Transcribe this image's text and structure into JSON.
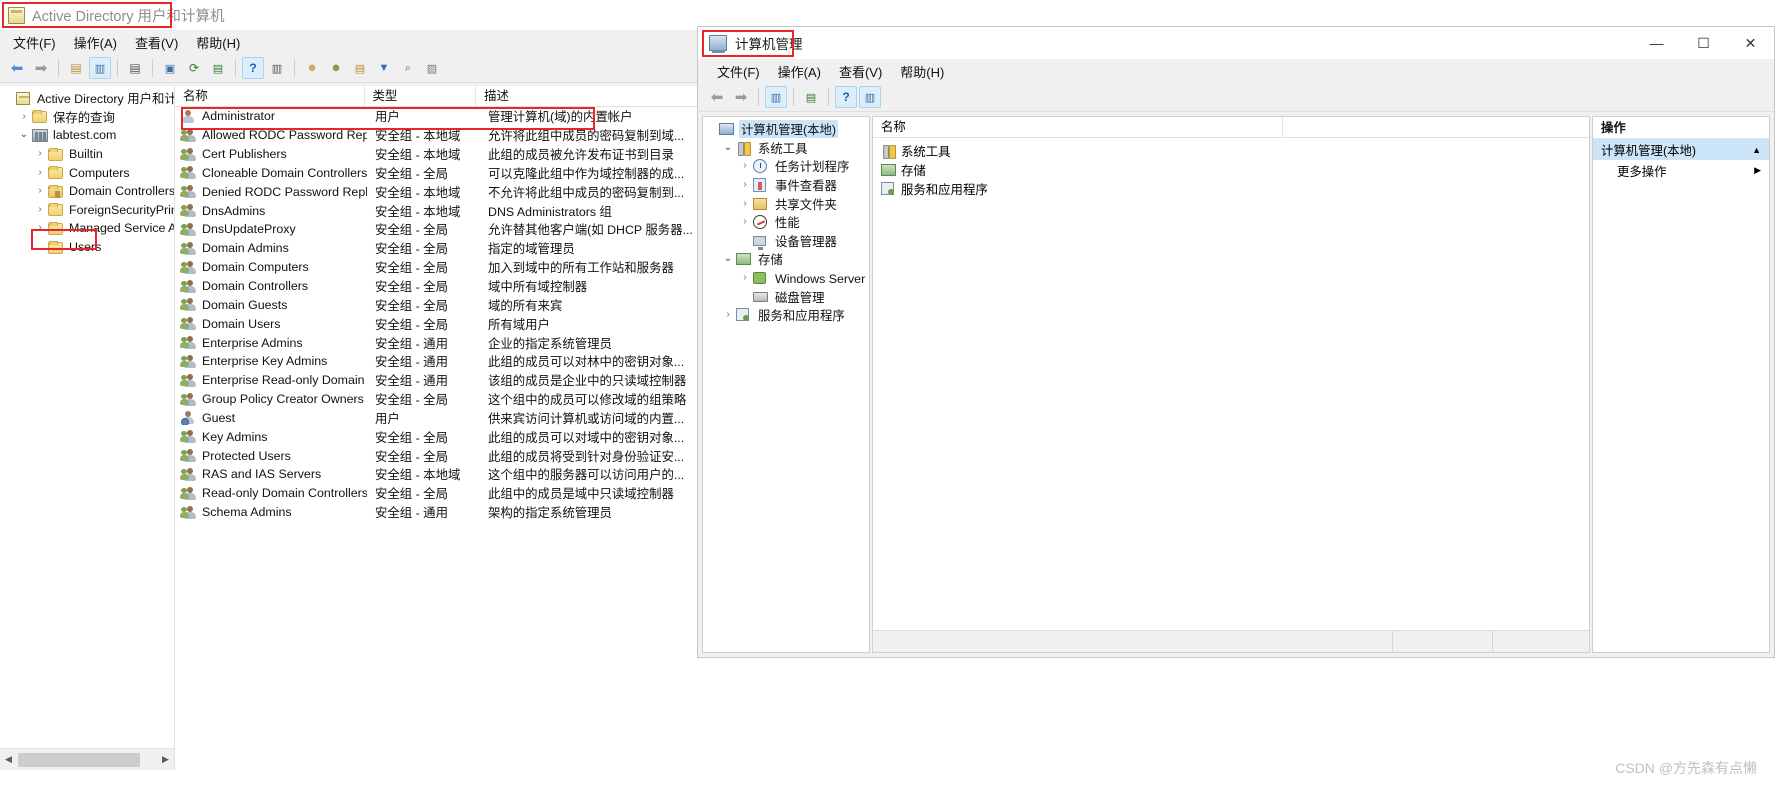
{
  "aduc": {
    "title": "Active Directory 用户和计算机",
    "title_icon": "console-icon",
    "menu": [
      "文件(F)",
      "操作(A)",
      "查看(V)",
      "帮助(H)"
    ],
    "toolbar_icons": [
      "back-arrow-icon",
      "forward-arrow-icon",
      "up-folder-icon",
      "show-tree-icon",
      "properties-icon",
      "refresh-panel-icon",
      "refresh-icon",
      "export-list-icon",
      "help-icon",
      "show-console-tree-icon",
      "new-user-icon",
      "new-group-icon",
      "new-ou-icon",
      "filter-icon",
      "find-icon",
      "saved-query-icon"
    ],
    "tree": [
      {
        "label": "Active Directory 用户和计算机",
        "icon": "console-root-icon",
        "indent": 0,
        "chevron": "none"
      },
      {
        "label": "保存的查询",
        "icon": "folder-icon",
        "indent": 1,
        "chevron": "collapsed"
      },
      {
        "label": "labtest.com",
        "icon": "domain-icon",
        "indent": 1,
        "chevron": "expanded"
      },
      {
        "label": "Builtin",
        "icon": "folder-icon",
        "indent": 2,
        "chevron": "collapsed"
      },
      {
        "label": "Computers",
        "icon": "folder-icon",
        "indent": 2,
        "chevron": "collapsed"
      },
      {
        "label": "Domain Controllers",
        "icon": "folder-ou-icon",
        "indent": 2,
        "chevron": "collapsed"
      },
      {
        "label": "ForeignSecurityPrincipals",
        "icon": "folder-icon",
        "indent": 2,
        "chevron": "collapsed"
      },
      {
        "label": "Managed Service Accounts",
        "icon": "folder-icon",
        "indent": 2,
        "chevron": "collapsed"
      },
      {
        "label": "Users",
        "icon": "folder-icon",
        "indent": 2,
        "chevron": "none",
        "highlighted": true
      }
    ],
    "columns": [
      "名称",
      "类型",
      "描述"
    ],
    "rows": [
      {
        "name": "Administrator",
        "type": "用户",
        "desc": "管理计算机(域)的内置帐户",
        "icon": "user-icon",
        "highlighted": true
      },
      {
        "name": "Allowed RODC Password Repl...",
        "type": "安全组 - 本地域",
        "desc": "允许将此组中成员的密码复制到域...",
        "icon": "group-icon"
      },
      {
        "name": "Cert Publishers",
        "type": "安全组 - 本地域",
        "desc": "此组的成员被允许发布证书到目录",
        "icon": "group-icon"
      },
      {
        "name": "Cloneable Domain Controllers",
        "type": "安全组 - 全局",
        "desc": "可以克隆此组中作为域控制器的成...",
        "icon": "group-icon"
      },
      {
        "name": "Denied RODC Password Repli...",
        "type": "安全组 - 本地域",
        "desc": "不允许将此组中成员的密码复制到...",
        "icon": "group-icon"
      },
      {
        "name": "DnsAdmins",
        "type": "安全组 - 本地域",
        "desc": "DNS Administrators 组",
        "icon": "group-icon"
      },
      {
        "name": "DnsUpdateProxy",
        "type": "安全组 - 全局",
        "desc": "允许替其他客户端(如 DHCP 服务器...",
        "icon": "group-icon"
      },
      {
        "name": "Domain Admins",
        "type": "安全组 - 全局",
        "desc": "指定的域管理员",
        "icon": "group-icon"
      },
      {
        "name": "Domain Computers",
        "type": "安全组 - 全局",
        "desc": "加入到域中的所有工作站和服务器",
        "icon": "group-icon"
      },
      {
        "name": "Domain Controllers",
        "type": "安全组 - 全局",
        "desc": "域中所有域控制器",
        "icon": "group-icon"
      },
      {
        "name": "Domain Guests",
        "type": "安全组 - 全局",
        "desc": "域的所有来宾",
        "icon": "group-icon"
      },
      {
        "name": "Domain Users",
        "type": "安全组 - 全局",
        "desc": "所有域用户",
        "icon": "group-icon"
      },
      {
        "name": "Enterprise Admins",
        "type": "安全组 - 通用",
        "desc": "企业的指定系统管理员",
        "icon": "group-icon"
      },
      {
        "name": "Enterprise Key Admins",
        "type": "安全组 - 通用",
        "desc": "此组的成员可以对林中的密钥对象...",
        "icon": "group-icon"
      },
      {
        "name": "Enterprise Read-only Domain ...",
        "type": "安全组 - 通用",
        "desc": "该组的成员是企业中的只读域控制器",
        "icon": "group-icon"
      },
      {
        "name": "Group Policy Creator Owners",
        "type": "安全组 - 全局",
        "desc": "这个组中的成员可以修改域的组策略",
        "icon": "group-icon"
      },
      {
        "name": "Guest",
        "type": "用户",
        "desc": "供来宾访问计算机或访问域的内置...",
        "icon": "guest-user-icon"
      },
      {
        "name": "Key Admins",
        "type": "安全组 - 全局",
        "desc": "此组的成员可以对域中的密钥对象...",
        "icon": "group-icon"
      },
      {
        "name": "Protected Users",
        "type": "安全组 - 全局",
        "desc": "此组的成员将受到针对身份验证安...",
        "icon": "group-icon"
      },
      {
        "name": "RAS and IAS Servers",
        "type": "安全组 - 本地域",
        "desc": "这个组中的服务器可以访问用户的...",
        "icon": "group-icon"
      },
      {
        "name": "Read-only Domain Controllers",
        "type": "安全组 - 全局",
        "desc": "此组中的成员是域中只读域控制器",
        "icon": "group-icon"
      },
      {
        "name": "Schema Admins",
        "type": "安全组 - 通用",
        "desc": "架构的指定系统管理员",
        "icon": "group-icon"
      }
    ]
  },
  "compmgmt": {
    "title": "计算机管理",
    "title_icon": "computer-management-icon",
    "window_controls": {
      "minimize": "—",
      "maximize": "☐",
      "close": "✕"
    },
    "menu": [
      "文件(F)",
      "操作(A)",
      "查看(V)",
      "帮助(H)"
    ],
    "toolbar_icons": [
      "back-arrow-icon",
      "forward-arrow-icon",
      "show-tree-icon",
      "export-list-icon",
      "help-icon",
      "show-console-tree-icon"
    ],
    "tree": [
      {
        "label": "计算机管理(本地)",
        "icon": "computer-management-icon",
        "indent": 0,
        "chevron": "none",
        "selected": true
      },
      {
        "label": "系统工具",
        "icon": "system-tools-icon",
        "indent": 1,
        "chevron": "expanded"
      },
      {
        "label": "任务计划程序",
        "icon": "task-scheduler-icon",
        "indent": 2,
        "chevron": "collapsed"
      },
      {
        "label": "事件查看器",
        "icon": "event-viewer-icon",
        "indent": 2,
        "chevron": "collapsed"
      },
      {
        "label": "共享文件夹",
        "icon": "shared-folders-icon",
        "indent": 2,
        "chevron": "collapsed"
      },
      {
        "label": "性能",
        "icon": "performance-icon",
        "indent": 2,
        "chevron": "collapsed"
      },
      {
        "label": "设备管理器",
        "icon": "device-manager-icon",
        "indent": 2,
        "chevron": "none"
      },
      {
        "label": "存储",
        "icon": "storage-icon",
        "indent": 1,
        "chevron": "expanded"
      },
      {
        "label": "Windows Server 备份",
        "icon": "windows-server-backup-icon",
        "indent": 2,
        "chevron": "collapsed"
      },
      {
        "label": "磁盘管理",
        "icon": "disk-management-icon",
        "indent": 2,
        "chevron": "none"
      },
      {
        "label": "服务和应用程序",
        "icon": "services-and-applications-icon",
        "indent": 1,
        "chevron": "collapsed"
      }
    ],
    "list_columns": [
      "名称",
      ""
    ],
    "list_rows": [
      {
        "label": "系统工具",
        "icon": "system-tools-icon"
      },
      {
        "label": "存储",
        "icon": "storage-icon"
      },
      {
        "label": "服务和应用程序",
        "icon": "services-and-applications-icon"
      }
    ],
    "actions": {
      "title": "操作",
      "selected_item": "计算机管理(本地)",
      "selected_caret": "▲",
      "items": [
        {
          "label": "更多操作",
          "caret": "▶"
        }
      ]
    }
  },
  "watermark": "CSDN @方先森有点懒",
  "colors": {
    "highlight_red": "#e8252a",
    "selection_blue": "#cce4f7",
    "window_bg": "#f0f0f0"
  }
}
